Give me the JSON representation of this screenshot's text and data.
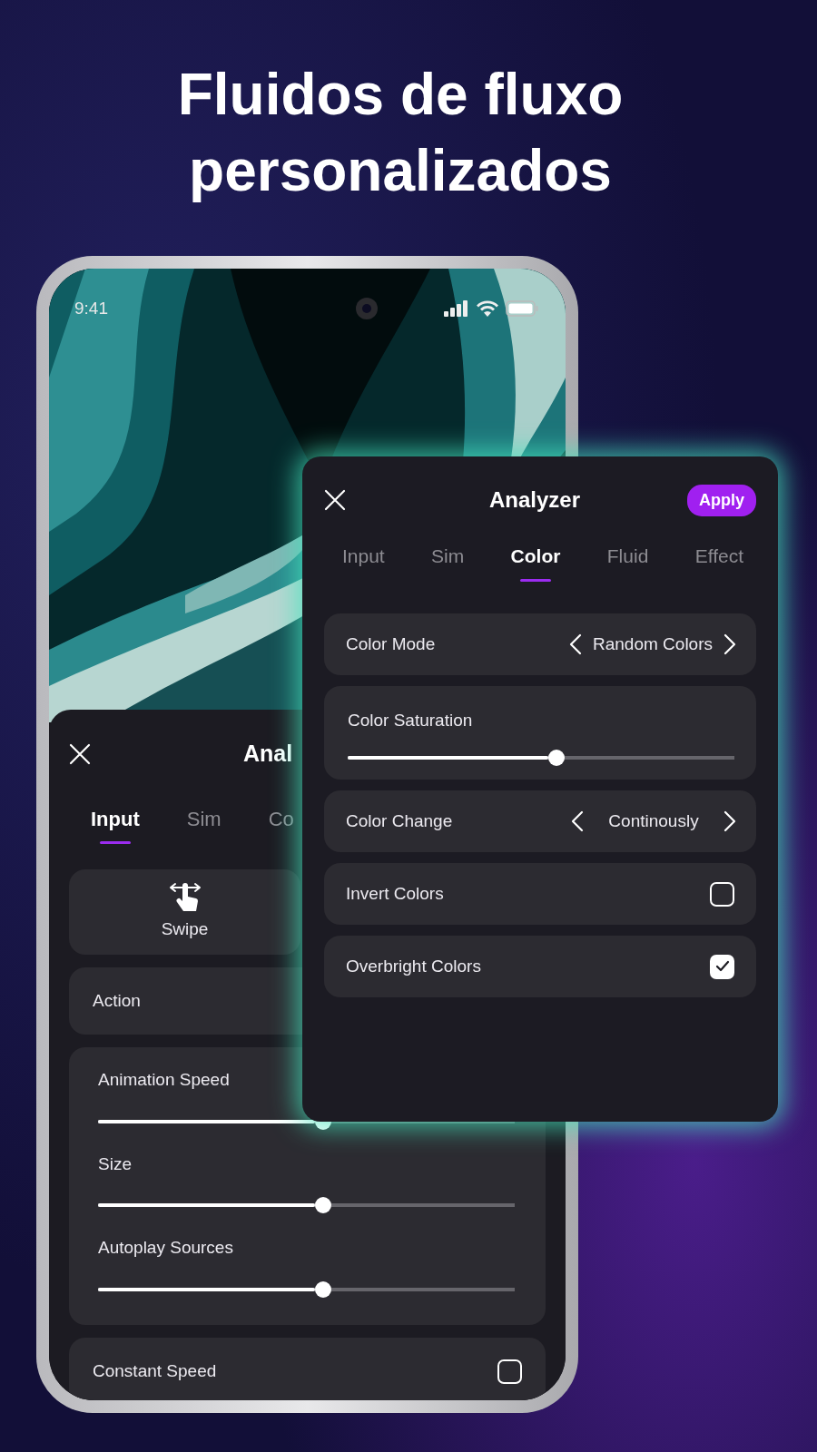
{
  "headline": "Fluidos de fluxo personalizados",
  "status_bar": {
    "time": "9:41"
  },
  "back_sheet": {
    "title": "Anal",
    "tabs": [
      {
        "label": "Input",
        "selected": true
      },
      {
        "label": "Sim",
        "selected": false
      },
      {
        "label": "Co",
        "selected": false
      }
    ],
    "modes": [
      {
        "label": "Swipe"
      }
    ],
    "rows": [
      {
        "kind": "option",
        "label": "Action"
      },
      {
        "kind": "sliders",
        "sliders": [
          {
            "label": "Animation Speed",
            "level": 0.54
          },
          {
            "label": "Size",
            "level": 0.54
          },
          {
            "label": "Autoplay Sources",
            "level": 0.54
          }
        ]
      },
      {
        "kind": "checkbox",
        "label": "Constant Speed",
        "checked": false
      }
    ]
  },
  "popup": {
    "title": "Analyzer",
    "apply": "Apply",
    "tabs": [
      {
        "label": "Input",
        "selected": false
      },
      {
        "label": "Sim",
        "selected": false
      },
      {
        "label": "Color",
        "selected": true
      },
      {
        "label": "Fluid",
        "selected": false
      },
      {
        "label": "Effect",
        "selected": false
      }
    ],
    "rows": [
      {
        "kind": "selector",
        "label": "Color Mode",
        "value": "Random Colors"
      },
      {
        "kind": "slider",
        "label": "Color Saturation",
        "level": 0.54
      },
      {
        "kind": "selector",
        "label": "Color Change",
        "value": "Continously"
      },
      {
        "kind": "checkbox",
        "label": "Invert Colors",
        "checked": false
      },
      {
        "kind": "checkbox",
        "label": "Overbright Colors",
        "checked": true
      }
    ]
  }
}
